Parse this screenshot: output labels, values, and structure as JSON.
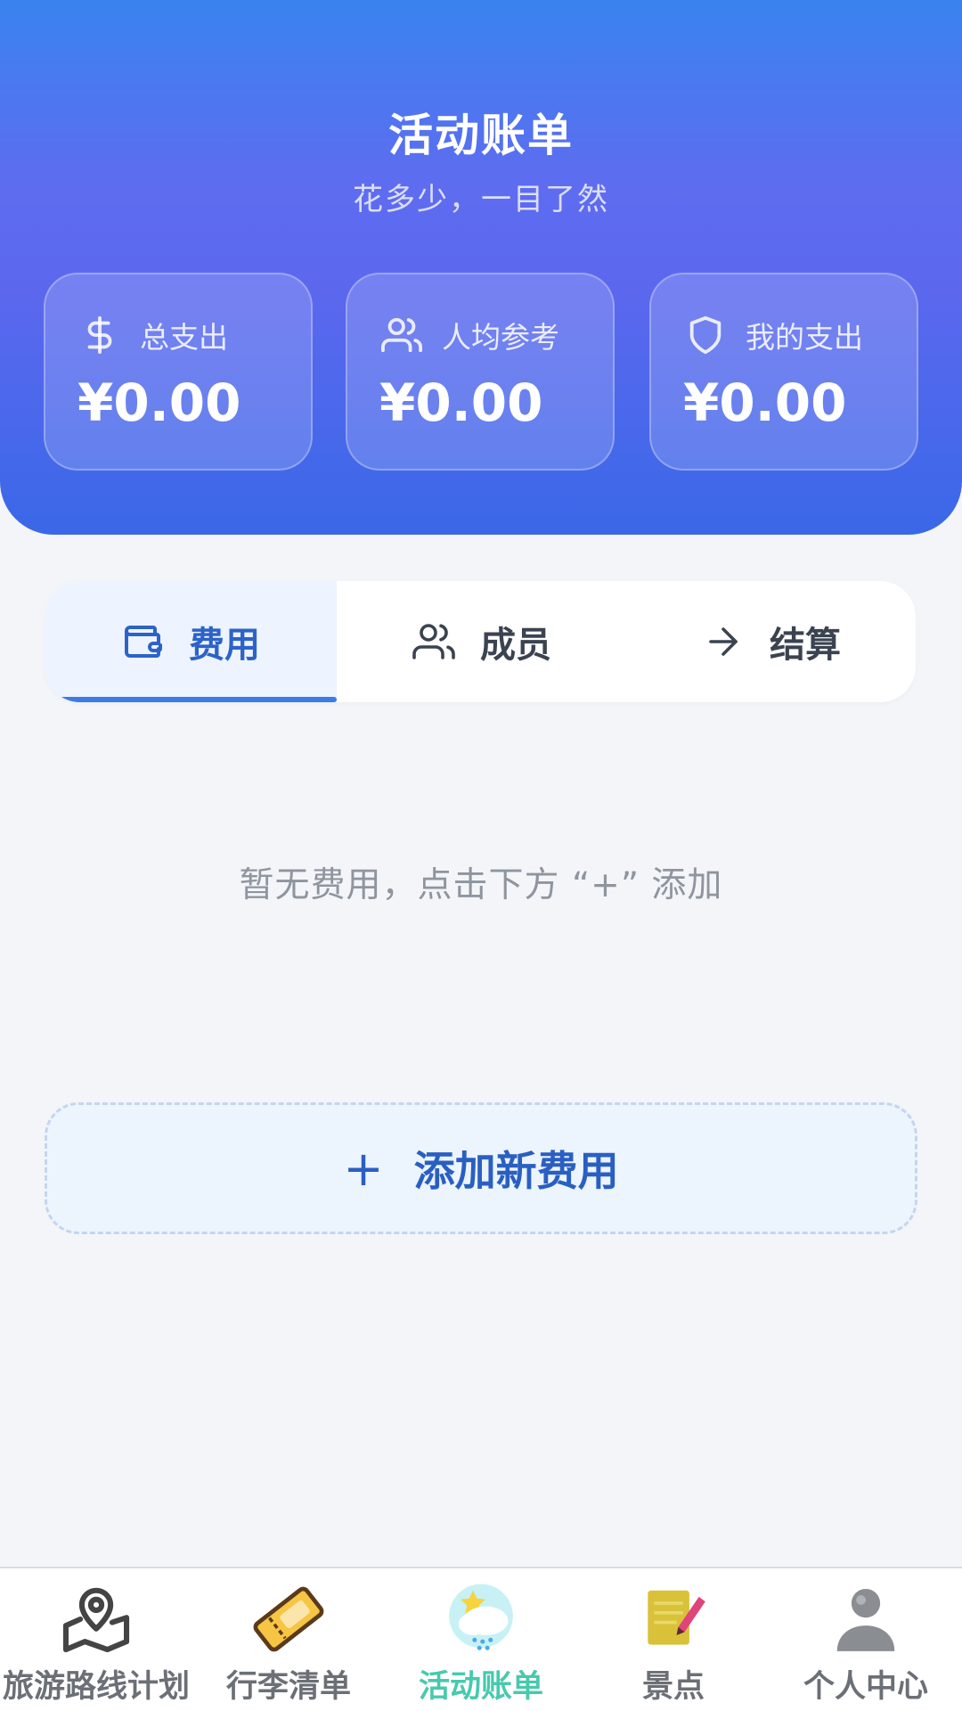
{
  "header": {
    "title": "活动账单",
    "subtitle": "花多少，一目了然"
  },
  "stats": [
    {
      "icon": "dollar-icon",
      "label": "总支出",
      "value": "¥0.00"
    },
    {
      "icon": "users-icon",
      "label": "人均参考",
      "value": "¥0.00"
    },
    {
      "icon": "shield-icon",
      "label": "我的支出",
      "value": "¥0.00"
    }
  ],
  "tabs": [
    {
      "icon": "wallet-icon",
      "label": "费用",
      "active": true
    },
    {
      "icon": "users-icon",
      "label": "成员",
      "active": false
    },
    {
      "icon": "arrow-right-icon",
      "label": "结算",
      "active": false
    }
  ],
  "empty_state": "暂无费用，点击下方 “+” 添加",
  "add_button": {
    "icon": "+",
    "label": "添加新费用"
  },
  "bottom_nav": [
    {
      "icon": "map-pin-icon",
      "label": "旅游路线计划",
      "active": false
    },
    {
      "icon": "ticket-icon",
      "label": "行李清单",
      "active": false
    },
    {
      "icon": "weather-icon",
      "label": "活动账单",
      "active": true
    },
    {
      "icon": "notepad-icon",
      "label": "景点",
      "active": false
    },
    {
      "icon": "person-icon",
      "label": "个人中心",
      "active": false
    }
  ],
  "colors": {
    "primary": "#3a68e8",
    "accent_active_nav": "#48c9ad",
    "tab_active_text": "#2d63c8"
  }
}
